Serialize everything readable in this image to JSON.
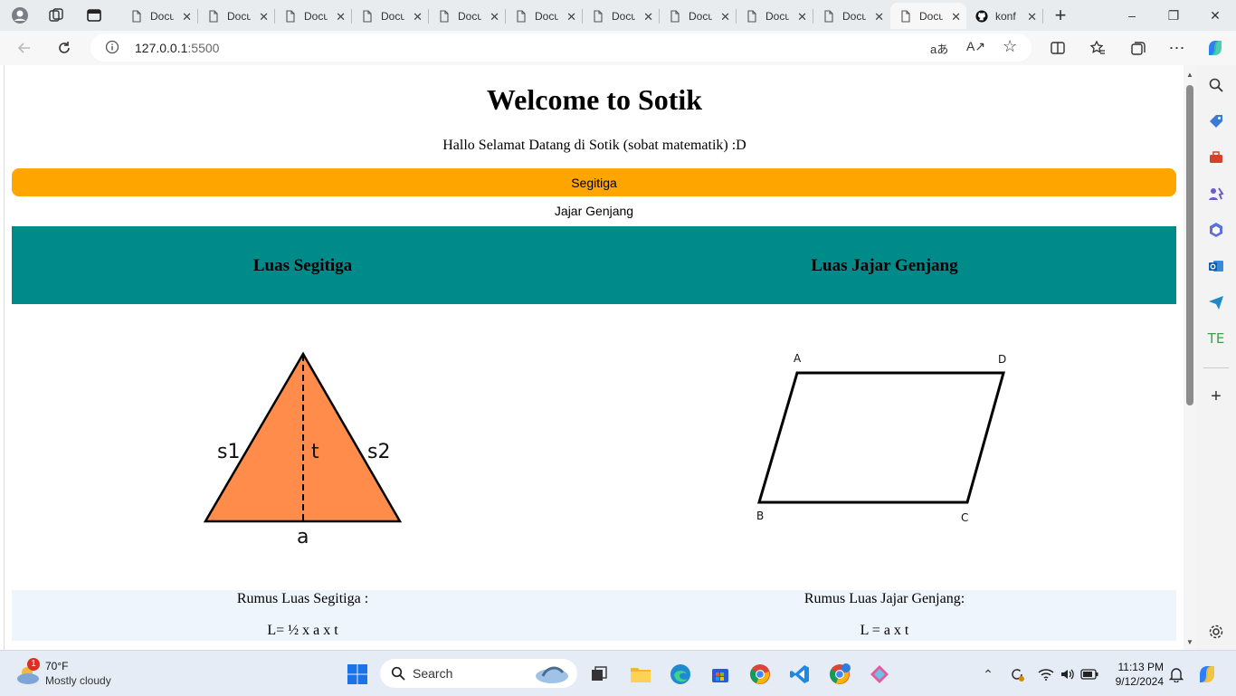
{
  "browser": {
    "tabs": [
      {
        "label": "Docu"
      },
      {
        "label": "Docu"
      },
      {
        "label": "Docu"
      },
      {
        "label": "Docu"
      },
      {
        "label": "Docu"
      },
      {
        "label": "Docu"
      },
      {
        "label": "Docu"
      },
      {
        "label": "Docu"
      },
      {
        "label": "Docu"
      },
      {
        "label": "Docu"
      },
      {
        "label": "Docu"
      },
      {
        "label": "konf"
      }
    ],
    "address": {
      "host": "127.0.0.1",
      "port": ":5500"
    }
  },
  "page": {
    "title": "Welcome to Sotik",
    "subtitle": "Hallo Selamat Datang di Sotik (sobat matematik) :D",
    "nav": [
      {
        "label": "Segitiga"
      },
      {
        "label": "Jajar Genjang"
      }
    ],
    "sections": [
      {
        "heading": "Luas Segitiga",
        "formula_title": "Rumus Luas Segitiga :",
        "formula": "L= ½ x a x t"
      },
      {
        "heading": "Luas Jajar Genjang",
        "formula_title": "Rumus Luas Jajar Genjang:",
        "formula": "L = a x t"
      }
    ],
    "triangle_labels": {
      "s1": "s1",
      "t": "t",
      "s2": "s2",
      "a": "a"
    },
    "parallelogram_labels": {
      "A": "A",
      "B": "B",
      "C": "C",
      "D": "D"
    },
    "triangle_fill": "#ff8c4a",
    "nav_active_color": "#ffa500",
    "band_color": "#008b8b"
  },
  "taskbar": {
    "weather": {
      "temp": "70°F",
      "desc": "Mostly cloudy",
      "badge": "1"
    },
    "search_label": "Search",
    "clock": {
      "time": "11:13 PM",
      "date": "9/12/2024"
    }
  }
}
